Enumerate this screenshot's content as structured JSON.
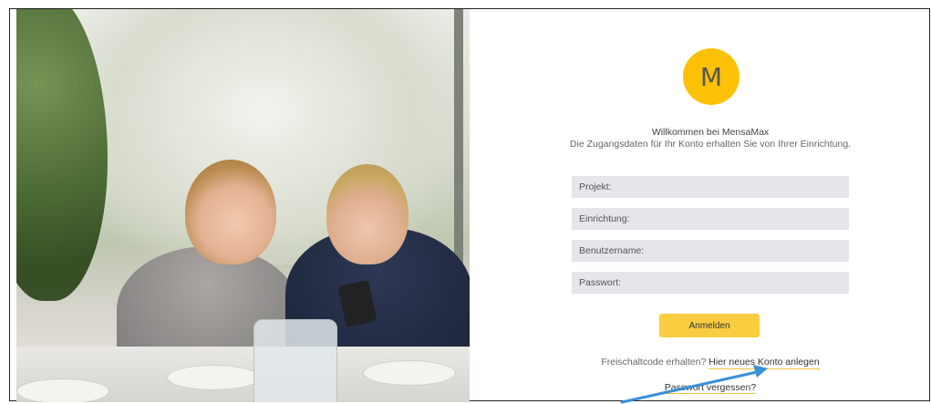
{
  "logo": {
    "letter": "M",
    "color": "#fcc107"
  },
  "welcome": {
    "title": "Willkommen bei MensaMax",
    "subtitle": "Die Zugangsdaten für Ihr Konto erhalten Sie von Ihrer Einrichtung."
  },
  "form": {
    "project_placeholder": "Projekt:",
    "institution_placeholder": "Einrichtung:",
    "username_placeholder": "Benutzername:",
    "password_placeholder": "Passwort:",
    "login_label": "Anmelden"
  },
  "register": {
    "prompt": "Freischaltcode erhalten?",
    "link": "Hier neues Konto anlegen"
  },
  "forgot_password": "Passwort vergessen?",
  "colors": {
    "accent": "#fcc107",
    "button": "#f8cd3f",
    "field": "#e5e6e9",
    "annotation_arrow": "#3b8fd8"
  }
}
